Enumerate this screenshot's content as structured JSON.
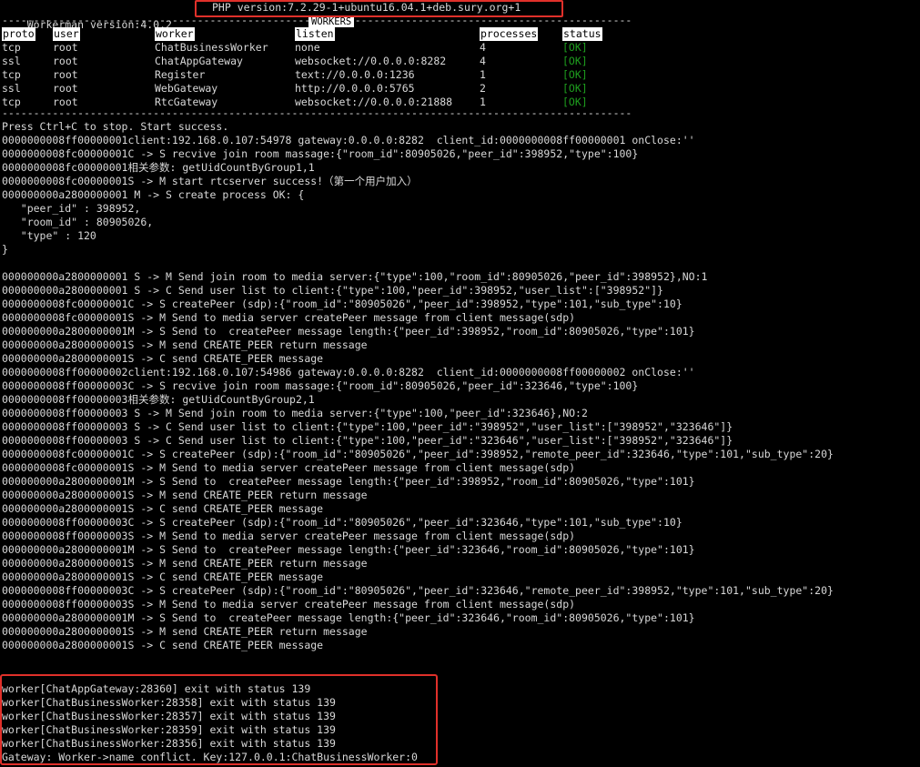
{
  "header": {
    "workerman_version": "Workerman version:4.0.2",
    "php_version": "PHP version:7.2.29-1+ubuntu16.04.1+deb.sury.org+1",
    "workers_label": "WORKERS",
    "separator": "----------------------------------------------------------------------------------------------------"
  },
  "table": {
    "columns": [
      "proto",
      "user",
      "worker",
      "listen",
      "processes",
      "status"
    ],
    "rows": [
      {
        "proto": "tcp",
        "user": "root",
        "worker": "ChatBusinessWorker",
        "listen": "none",
        "processes": "4",
        "status": "[OK]"
      },
      {
        "proto": "ssl",
        "user": "root",
        "worker": "ChatAppGateway",
        "listen": "websocket://0.0.0.0:8282",
        "processes": "4",
        "status": "[OK]"
      },
      {
        "proto": "tcp",
        "user": "root",
        "worker": "Register",
        "listen": "text://0.0.0.0:1236",
        "processes": "1",
        "status": "[OK]"
      },
      {
        "proto": "ssl",
        "user": "root",
        "worker": "WebGateway",
        "listen": "http://0.0.0.0:5765",
        "processes": "2",
        "status": "[OK]"
      },
      {
        "proto": "tcp",
        "user": "root",
        "worker": "RtcGateway",
        "listen": "websocket://0.0.0.0:21888",
        "processes": "1",
        "status": "[OK]"
      }
    ]
  },
  "log": [
    "Press Ctrl+C to stop. Start success.",
    "0000000008ff00000001client:192.168.0.107:54978 gateway:0.0.0.0:8282  client_id:0000000008ff00000001 onClose:''",
    "0000000008fc00000001C -> S recvive join room massage:{\"room_id\":80905026,\"peer_id\":398952,\"type\":100}",
    "0000000008fc00000001相关参数: getUidCountByGroup1,1",
    "0000000008fc00000001S -> M start rtcserver success!（第一个用户加入）",
    "000000000a2800000001 M -> S create process OK: {",
    "   \"peer_id\" : 398952,",
    "   \"room_id\" : 80905026,",
    "   \"type\" : 120",
    "}",
    "",
    "000000000a2800000001 S -> M Send join room to media server:{\"type\":100,\"room_id\":80905026,\"peer_id\":398952},NO:1",
    "000000000a2800000001 S -> C Send user list to client:{\"type\":100,\"peer_id\":398952,\"user_list\":[\"398952\"]}",
    "0000000008fc00000001C -> S createPeer (sdp):{\"room_id\":\"80905026\",\"peer_id\":398952,\"type\":101,\"sub_type\":10}",
    "0000000008fc00000001S -> M Send to media server createPeer message from client message(sdp)",
    "000000000a2800000001M -> S Send to  createPeer message length:{\"peer_id\":398952,\"room_id\":80905026,\"type\":101}",
    "000000000a2800000001S -> M send CREATE_PEER return message",
    "000000000a2800000001S -> C send CREATE_PEER message",
    "0000000008ff00000002client:192.168.0.107:54986 gateway:0.0.0.0:8282  client_id:0000000008ff00000002 onClose:''",
    "0000000008ff00000003C -> S recvive join room massage:{\"room_id\":80905026,\"peer_id\":323646,\"type\":100}",
    "0000000008ff00000003相关参数: getUidCountByGroup2,1",
    "0000000008ff00000003 S -> M Send join room to media server:{\"type\":100,\"peer_id\":323646},NO:2",
    "0000000008ff00000003 S -> C Send user list to client:{\"type\":100,\"peer_id\":\"398952\",\"user_list\":[\"398952\",\"323646\"]}",
    "0000000008ff00000003 S -> C Send user list to client:{\"type\":100,\"peer_id\":\"323646\",\"user_list\":[\"398952\",\"323646\"]}",
    "0000000008fc00000001C -> S createPeer (sdp):{\"room_id\":\"80905026\",\"peer_id\":398952,\"remote_peer_id\":323646,\"type\":101,\"sub_type\":20}",
    "0000000008fc00000001S -> M Send to media server createPeer message from client message(sdp)",
    "000000000a2800000001M -> S Send to  createPeer message length:{\"peer_id\":398952,\"room_id\":80905026,\"type\":101}",
    "000000000a2800000001S -> M send CREATE_PEER return message",
    "000000000a2800000001S -> C send CREATE_PEER message",
    "0000000008ff00000003C -> S createPeer (sdp):{\"room_id\":\"80905026\",\"peer_id\":323646,\"type\":101,\"sub_type\":10}",
    "0000000008ff00000003S -> M Send to media server createPeer message from client message(sdp)",
    "000000000a2800000001M -> S Send to  createPeer message length:{\"peer_id\":323646,\"room_id\":80905026,\"type\":101}",
    "000000000a2800000001S -> M send CREATE_PEER return message",
    "000000000a2800000001S -> C send CREATE_PEER message",
    "0000000008ff00000003C -> S createPeer (sdp):{\"room_id\":\"80905026\",\"peer_id\":323646,\"remote_peer_id\":398952,\"type\":101,\"sub_type\":20}",
    "0000000008ff00000003S -> M Send to media server createPeer message from client message(sdp)",
    "000000000a2800000001M -> S Send to  createPeer message length:{\"peer_id\":323646,\"room_id\":80905026,\"type\":101}",
    "000000000a2800000001S -> M send CREATE_PEER return message",
    "000000000a2800000001S -> C send CREATE_PEER message"
  ],
  "errors": [
    "worker[ChatAppGateway:28360] exit with status 139",
    "worker[ChatBusinessWorker:28358] exit with status 139",
    "worker[ChatBusinessWorker:28357] exit with status 139",
    "worker[ChatBusinessWorker:28359] exit with status 139",
    "worker[ChatBusinessWorker:28356] exit with status 139",
    "Gateway: Worker->name conflict. Key:127.0.0.1:ChatBusinessWorker:0"
  ],
  "colors": {
    "background": "#000000",
    "text": "#d8d8d8",
    "ok": "#1e9e1e",
    "highlight_border": "#e0302a"
  }
}
